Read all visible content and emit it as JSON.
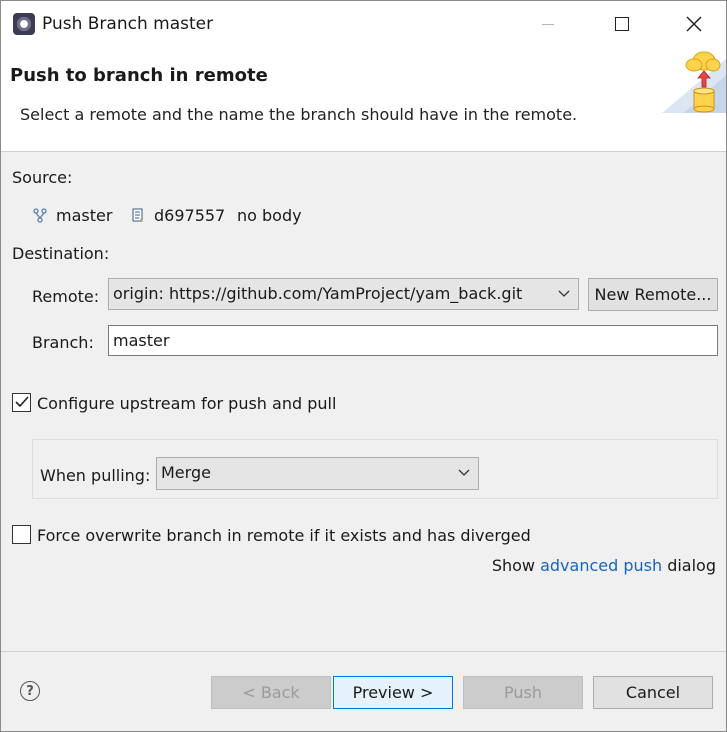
{
  "window": {
    "title": "Push Branch master"
  },
  "header": {
    "title": "Push to branch in remote",
    "description": "Select a remote and the name the branch should have in the remote."
  },
  "source": {
    "label": "Source:",
    "branch": "master",
    "commit_id": "d697557",
    "commit_message": "no body"
  },
  "destination": {
    "label": "Destination:",
    "remote_label": "Remote:",
    "remote_value": "origin: https://github.com/YamProject/yam_back.git",
    "new_remote_button": "New Remote...",
    "branch_label": "Branch:",
    "branch_value": "master"
  },
  "upstream": {
    "checkbox_label": "Configure upstream for push and pull",
    "checked": true,
    "when_pulling_label": "When pulling:",
    "when_pulling_value": "Merge"
  },
  "force": {
    "checkbox_label": "Force overwrite branch in remote if it exists and has diverged",
    "checked": false
  },
  "advanced": {
    "prefix": "Show",
    "link": "advanced push",
    "suffix": "dialog"
  },
  "footer": {
    "back": "< Back",
    "preview": "Preview >",
    "push": "Push",
    "cancel": "Cancel"
  },
  "icons": {
    "app": "eclipse-icon",
    "header": "cloud-push-icon",
    "branch": "branch-icon",
    "commit": "commit-icon",
    "help": "help-icon"
  }
}
